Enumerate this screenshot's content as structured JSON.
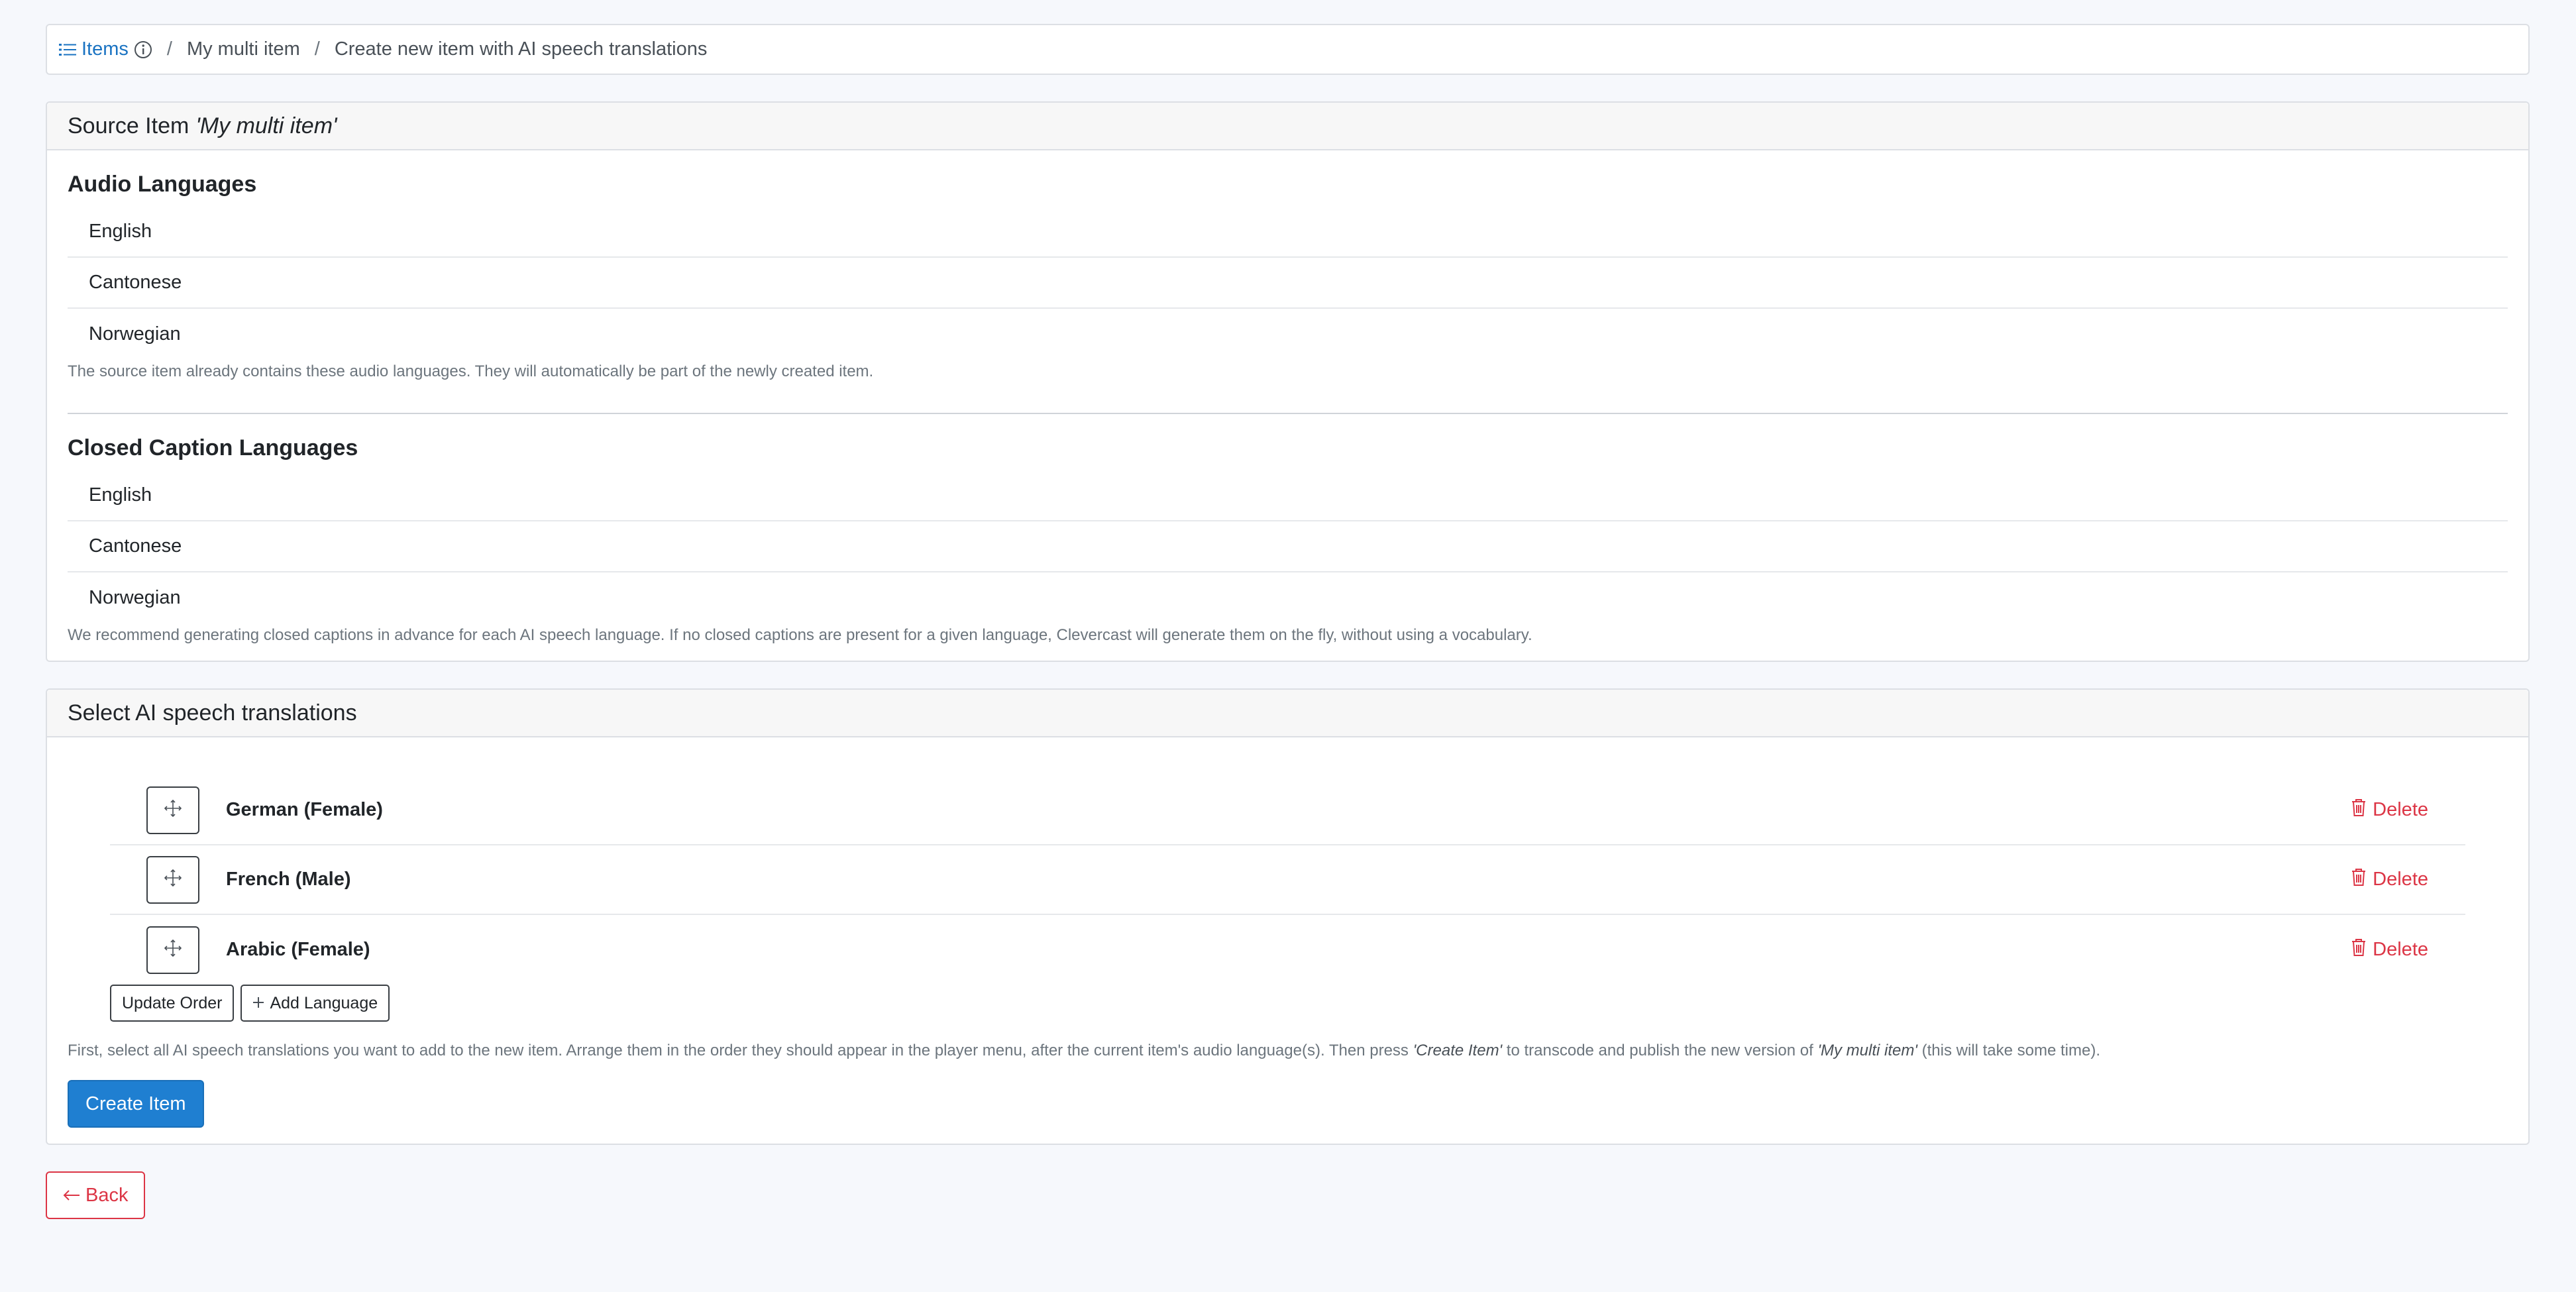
{
  "breadcrumb": {
    "items_label": "Items",
    "separator": "/",
    "item_name": "My multi item",
    "current": "Create new item with AI speech translations"
  },
  "source_card": {
    "header_prefix": "Source Item",
    "header_item": "'My multi item'",
    "audio": {
      "title": "Audio Languages",
      "languages": [
        "English",
        "Cantonese",
        "Norwegian"
      ],
      "help": "The source item already contains these audio languages. They will automatically be part of the newly created item."
    },
    "captions": {
      "title": "Closed Caption Languages",
      "languages": [
        "English",
        "Cantonese",
        "Norwegian"
      ],
      "help": "We recommend generating closed captions in advance for each AI speech language. If no closed captions are present for a given language, Clevercast will generate them on the fly, without using a vocabulary."
    }
  },
  "translations_card": {
    "header": "Select AI speech translations",
    "translations": [
      {
        "label": "German (Female)",
        "delete_label": "Delete"
      },
      {
        "label": "French (Male)",
        "delete_label": "Delete"
      },
      {
        "label": "Arabic (Female)",
        "delete_label": "Delete"
      }
    ],
    "update_order_label": "Update Order",
    "add_language_label": "Add Language",
    "instructions": {
      "part1": "First, select all AI speech translations you want to add to the new item. Arrange them in the order they should appear in the player menu, after the current item's audio language(s). Then press ",
      "em1": "'Create Item'",
      "part2": " to transcode and publish the new version of ",
      "em2": "'My multi item'",
      "part3": " (this will take some time)."
    },
    "create_label": "Create Item"
  },
  "back_label": "Back",
  "colors": {
    "accent": "#1f7fd1",
    "link": "#1a73c2",
    "danger": "#dc3545",
    "background": "#f6f8fc"
  },
  "icons": [
    "list-icon",
    "info-icon",
    "move-icon",
    "trash-icon",
    "plus-icon",
    "arrow-left-icon"
  ]
}
